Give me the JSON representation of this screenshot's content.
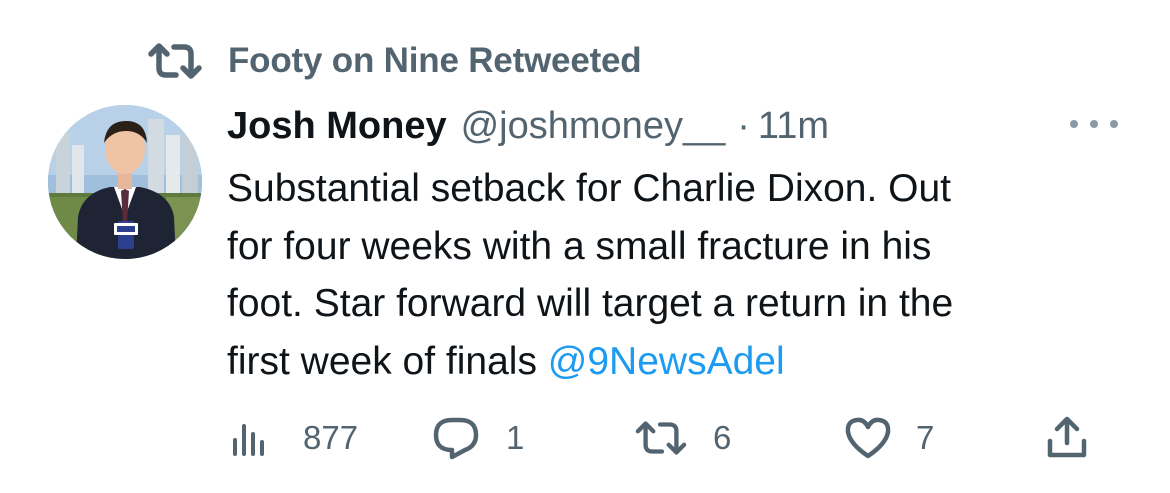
{
  "retweet_banner": {
    "icon": "retweet-icon",
    "text": "Footy on Nine Retweeted"
  },
  "tweet": {
    "author_name": "Josh Money",
    "handle": "@joshmoney__",
    "separator": "·",
    "time": "11m",
    "text_lines": [
      "Substantial setback for Charlie Dixon. Out",
      "for four weeks with a small fracture in his",
      "foot. Star forward will target a return in the",
      "first week of finals "
    ],
    "mention": "@9NewsAdel",
    "more_icon": "more-options-icon"
  },
  "actions": {
    "views": {
      "icon": "analytics-icon",
      "count": "877"
    },
    "replies": {
      "icon": "reply-icon",
      "count": "1"
    },
    "retweets": {
      "icon": "retweet-icon",
      "count": "6"
    },
    "likes": {
      "icon": "heart-icon",
      "count": "7"
    },
    "share": {
      "icon": "share-icon"
    }
  },
  "colors": {
    "text_primary": "#0f1419",
    "text_secondary": "#536471",
    "link": "#1d9bf0",
    "background": "#ffffff"
  }
}
